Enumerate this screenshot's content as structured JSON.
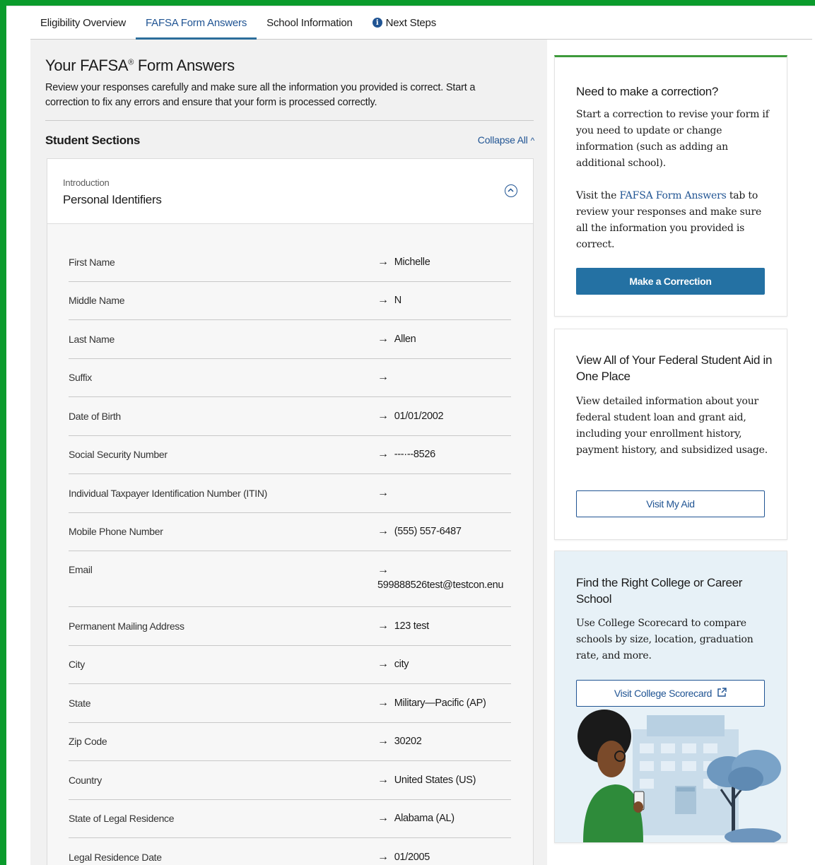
{
  "tabs": [
    {
      "label": "Eligibility Overview"
    },
    {
      "label": "FAFSA Form Answers"
    },
    {
      "label": "School Information"
    },
    {
      "label": "Next Steps"
    }
  ],
  "page": {
    "title": "Your FAFSA",
    "title_mark": "®",
    "title_suffix": " Form Answers",
    "intro": "Review your responses carefully and make sure all the information you provided is correct. Start a correction to fix any errors and ensure that your form is processed correctly."
  },
  "sections": {
    "title": "Student Sections",
    "collapse_label": "Collapse All"
  },
  "accordion": {
    "eyebrow": "Introduction",
    "title": "Personal Identifiers",
    "rows": [
      {
        "label": "First Name",
        "value": "Michelle"
      },
      {
        "label": "Middle Name",
        "value": "N"
      },
      {
        "label": "Last Name",
        "value": "Allen"
      },
      {
        "label": "Suffix",
        "value": ""
      },
      {
        "label": "Date of Birth",
        "value": "01/01/2002"
      },
      {
        "label": "Social Security Number",
        "value": "---·--8526"
      },
      {
        "label": "Individual Taxpayer Identification Number (ITIN)",
        "value": ""
      },
      {
        "label": "Mobile Phone Number",
        "value": "(555) 557-6487"
      },
      {
        "label": "Email",
        "value": "599888526test@testcon.enu"
      },
      {
        "label": "Permanent Mailing Address",
        "value": "123 test"
      },
      {
        "label": "City",
        "value": "city"
      },
      {
        "label": "State",
        "value": "Military—Pacific (AP)"
      },
      {
        "label": "Zip Code",
        "value": "30202"
      },
      {
        "label": "Country",
        "value": "United States (US)"
      },
      {
        "label": "State of Legal Residence",
        "value": "Alabama (AL)"
      },
      {
        "label": "Legal Residence Date",
        "value": "01/2005"
      }
    ]
  },
  "cards": {
    "correction": {
      "title": "Need to make a correction?",
      "body1": "Start a correction to revise your form if you need to update or change information (such as adding an additional school).",
      "body2_pre": "Visit the ",
      "body2_link": "FAFSA Form Answers",
      "body2_post": " tab to review your responses and make sure all the information you provided is correct.",
      "button": "Make a Correction"
    },
    "myaid": {
      "title": "View All of Your Federal Student Aid in One Place",
      "body": "View detailed information about your federal student loan and grant aid, including your enrollment history, payment history, and subsidized usage.",
      "button": "Visit My Aid"
    },
    "scorecard": {
      "title": "Find the Right College or Career School",
      "body": "Use College Scorecard to compare schools by size, location, graduation rate, and more.",
      "button": "Visit College Scorecard"
    }
  },
  "colors": {
    "brand_blue": "#205493",
    "accent_green": "#3e9a3b",
    "outer_green": "#0a9b2c"
  }
}
